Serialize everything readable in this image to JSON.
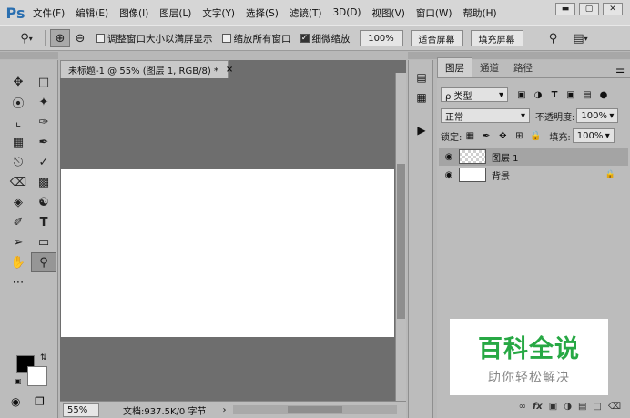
{
  "app": {
    "logo": "Ps"
  },
  "menu": [
    "文件(F)",
    "编辑(E)",
    "图像(I)",
    "图层(L)",
    "文字(Y)",
    "选择(S)",
    "滤镜(T)",
    "3D(D)",
    "视图(V)",
    "窗口(W)",
    "帮助(H)"
  ],
  "window_controls": {
    "minimize": "▬",
    "maximize": "▢",
    "close": "✕"
  },
  "options": {
    "zoom_tool_icon": "magnifier-icon",
    "resize_windows": "调整窗口大小以满屏显示",
    "zoom_all": "缩放所有窗口",
    "scrubby": "细微缩放",
    "btn_100": "100%",
    "btn_fit": "适合屏幕",
    "btn_fill": "填充屏幕"
  },
  "document": {
    "tab_title": "未标题-1 @ 55% (图层 1, RGB/8) *",
    "tab_close": "×",
    "zoom": "55%",
    "info": "文档:937.5K/0 字节",
    "status_arrow": "›"
  },
  "panel": {
    "tabs": [
      "图层",
      "通道",
      "路径"
    ],
    "filter_kind": "ρ 类型",
    "blend_mode": "正常",
    "opacity_label": "不透明度:",
    "opacity_value": "100%",
    "lock_label": "锁定:",
    "fill_label": "填充:",
    "fill_value": "100%",
    "layers": [
      {
        "name": "图层 1",
        "selected": true
      },
      {
        "name": "背景",
        "selected": false
      }
    ]
  },
  "watermark": {
    "title": "百科全说",
    "subtitle": "助你轻松解决"
  },
  "colors": {
    "watermark_green": "#27a844",
    "ps_blue": "#2a6fb0"
  }
}
